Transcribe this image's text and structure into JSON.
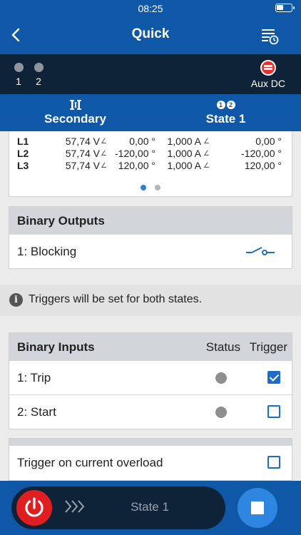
{
  "status": {
    "time": "08:25"
  },
  "header": {
    "title": "Quick"
  },
  "band": {
    "states": [
      {
        "num": "1"
      },
      {
        "num": "2"
      }
    ],
    "aux_label": "Aux DC"
  },
  "tabs": [
    {
      "label": "Secondary",
      "icon": "secondary-icon"
    },
    {
      "label": "State 1",
      "icon": "state-1-2-icon",
      "badges": [
        "1",
        "2"
      ]
    }
  ],
  "values": {
    "rows": [
      {
        "phase": "L1",
        "voltage": "57,74 V",
        "v_angle": "0,00 °",
        "current": "1,000 A",
        "c_angle": "0,00 °"
      },
      {
        "phase": "L2",
        "voltage": "57,74 V",
        "v_angle": "-120,00 °",
        "current": "1,000 A",
        "c_angle": "-120,00 °"
      },
      {
        "phase": "L3",
        "voltage": "57,74 V",
        "v_angle": "120,00 °",
        "current": "1,000 A",
        "c_angle": "120,00 °"
      }
    ],
    "angle_symbol": "∠"
  },
  "binary_outputs": {
    "title": "Binary Outputs",
    "items": [
      {
        "label": "1: Blocking",
        "icon": "switch-open-icon"
      }
    ]
  },
  "info": {
    "text": "Triggers will be set for both states."
  },
  "binary_inputs": {
    "title": "Binary Inputs",
    "status_label": "Status",
    "trigger_label": "Trigger",
    "items": [
      {
        "label": "1: Trip",
        "trigger": true
      },
      {
        "label": "2: Start",
        "trigger": false
      }
    ]
  },
  "overload": {
    "label": "Trigger on current overload",
    "checked": false
  },
  "bottom": {
    "state_label": "State 1"
  },
  "colors": {
    "primary": "#0f58a8",
    "dark": "#0e2338",
    "accent": "#2f86e0",
    "danger": "#e01e22"
  }
}
